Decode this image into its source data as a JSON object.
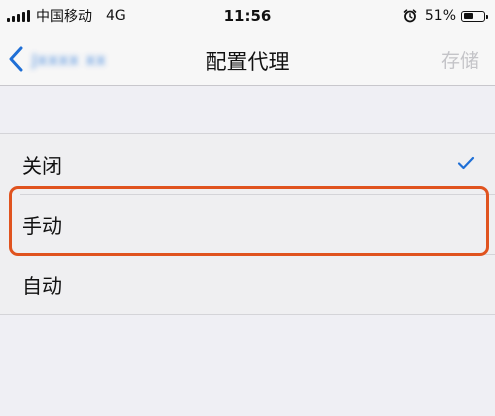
{
  "status_bar": {
    "carrier": "中国移动",
    "network": "4G",
    "time": "11:56",
    "battery_percent": "51%",
    "battery_level": 0.51,
    "icons": [
      "signal-icon",
      "alarm-icon",
      "battery-icon"
    ]
  },
  "nav": {
    "back_label": "Jxxxx xx",
    "title": "配置代理",
    "save_label": "存储"
  },
  "options": [
    {
      "label": "关闭",
      "selected": true
    },
    {
      "label": "手动",
      "selected": false
    },
    {
      "label": "自动",
      "selected": false
    }
  ],
  "colors": {
    "accent": "#1f6fd6",
    "highlight": "#e0531f",
    "disabled": "#c4c4c8"
  }
}
